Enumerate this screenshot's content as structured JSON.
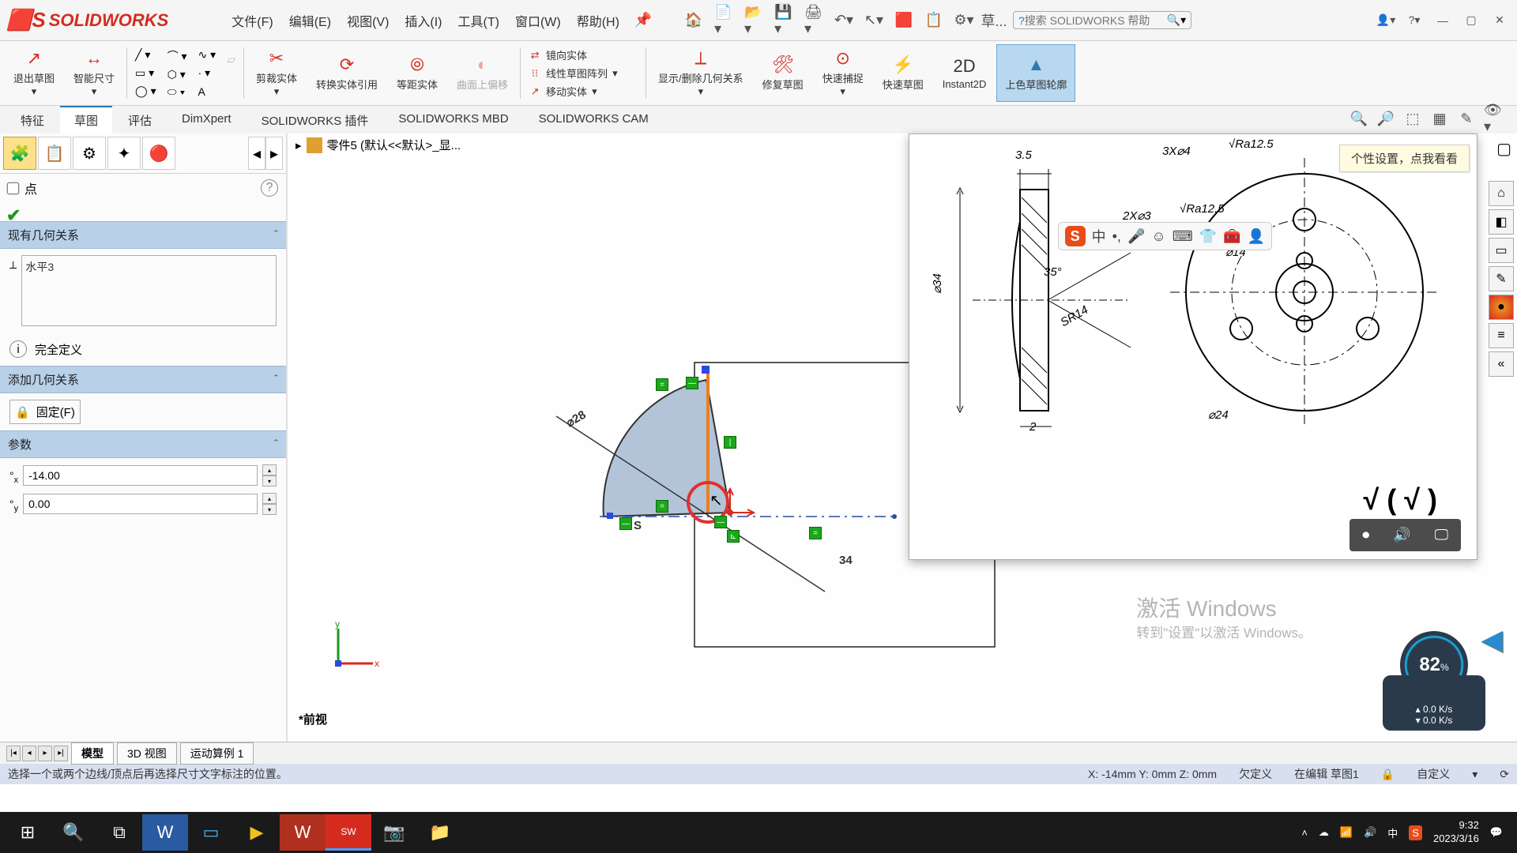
{
  "app": {
    "name": "SOLIDWORKS"
  },
  "menu": {
    "file": "文件(F)",
    "edit": "编辑(E)",
    "view": "视图(V)",
    "insert": "插入(I)",
    "tools": "工具(T)",
    "window": "窗口(W)",
    "help": "帮助(H)"
  },
  "search": {
    "placeholder": "搜索 SOLIDWORKS 帮助",
    "prefix_btn": "草..."
  },
  "tooltip": "个性设置，点我看看",
  "ribbon": {
    "exit_sketch": "退出草图",
    "smart_dim": "智能尺寸",
    "trim": "剪裁实体",
    "convert": "转换实体引用",
    "offset": "等距实体",
    "onface": "曲面上偏移",
    "mirror": "镜向实体",
    "pattern": "线性草图阵列",
    "move": "移动实体",
    "showrel": "显示/删除几何关系",
    "repair": "修复草图",
    "quicksnap": "快速捕捉",
    "rapid": "快速草图",
    "instant": "Instant2D",
    "shaded": "上色草图轮廓"
  },
  "ftabs": {
    "feature": "特征",
    "sketch": "草图",
    "eval": "评估",
    "dimxpert": "DimXpert",
    "addins": "SOLIDWORKS 插件",
    "mbd": "SOLIDWORKS MBD",
    "cam": "SOLIDWORKS CAM"
  },
  "breadcrumb": "零件5 (默认<<默认>_显...",
  "left": {
    "entity": "点",
    "section_existing": "现有几何关系",
    "relations": [
      "水平3"
    ],
    "status_label": "完全定义",
    "section_add": "添加几何关系",
    "fix_btn": "固定(F)",
    "section_param": "参数",
    "x_val": "-14.00",
    "y_val": "0.00"
  },
  "canvas": {
    "view_name": "*前视",
    "dim28": "⌀28",
    "dim_s": "S",
    "dim34": "34"
  },
  "ref": {
    "d35": "3.5",
    "d2": "2",
    "d34": "⌀34",
    "a35": "35°",
    "sr14": "SR14",
    "txt1": "3X⌀4",
    "ra1": "Ra12.5",
    "txt2": "2X⌀3",
    "ra2": "Ra12.5",
    "d14": "⌀14",
    "d24": "⌀24",
    "surface": "√  ( √ )"
  },
  "speed": {
    "pct": "82",
    "unit": "%",
    "up": "0.0 K/s",
    "down": "0.0 K/s"
  },
  "bottom_tabs": {
    "model": "模型",
    "v3d": "3D 视图",
    "motion": "运动算例 1"
  },
  "status": {
    "hint": "选择一个或两个边线/顶点后再选择尺寸文字标注的位置。",
    "coord": "X: -14mm Y: 0mm Z: 0mm",
    "underdef": "欠定义",
    "editmode": "在编辑 草图1",
    "custom": "自定义"
  },
  "watermark": {
    "line1": "激活 Windows",
    "line2": "转到\"设置\"以激活 Windows。"
  },
  "tray": {
    "ime": "中",
    "time": "9:32",
    "date": "2023/3/16"
  }
}
